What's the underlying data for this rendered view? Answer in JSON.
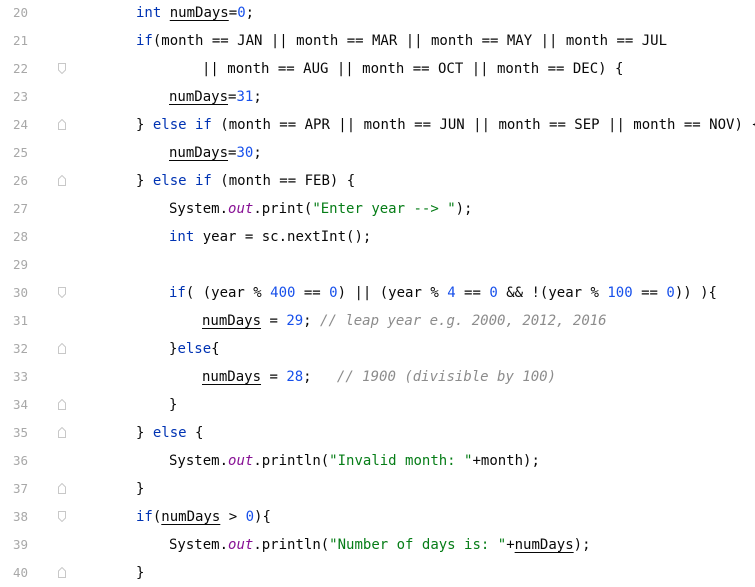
{
  "editor": {
    "lines": [
      {
        "num": "20",
        "fold": false,
        "indent": 0,
        "tokens": [
          [
            "kw",
            "int"
          ],
          [
            "p",
            " "
          ],
          [
            "var",
            "numDays"
          ],
          [
            "p",
            "="
          ],
          [
            "num",
            "0"
          ],
          [
            "p",
            ";"
          ]
        ]
      },
      {
        "num": "21",
        "fold": false,
        "indent": 0,
        "tokens": [
          [
            "kw",
            "if"
          ],
          [
            "p",
            "(month == JAN || month == MAR || month == MAY || month == JUL"
          ]
        ]
      },
      {
        "num": "22",
        "fold": true,
        "foldType": "open",
        "indent": 2,
        "tokens": [
          [
            "p",
            "|| month == AUG || month == OCT || month == DEC) {"
          ]
        ]
      },
      {
        "num": "23",
        "fold": false,
        "indent": 1,
        "tokens": [
          [
            "var",
            "numDays"
          ],
          [
            "p",
            "="
          ],
          [
            "num",
            "31"
          ],
          [
            "p",
            ";"
          ]
        ]
      },
      {
        "num": "24",
        "fold": true,
        "foldType": "mid",
        "indent": 0,
        "tokens": [
          [
            "p",
            "} "
          ],
          [
            "kw",
            "else if"
          ],
          [
            "p",
            " (month == APR || month == JUN || month == SEP || month == NOV) {"
          ]
        ]
      },
      {
        "num": "25",
        "fold": false,
        "indent": 1,
        "tokens": [
          [
            "var",
            "numDays"
          ],
          [
            "p",
            "="
          ],
          [
            "num",
            "30"
          ],
          [
            "p",
            ";"
          ]
        ]
      },
      {
        "num": "26",
        "fold": true,
        "foldType": "mid",
        "indent": 0,
        "tokens": [
          [
            "p",
            "} "
          ],
          [
            "kw",
            "else if"
          ],
          [
            "p",
            " (month == FEB) {"
          ]
        ]
      },
      {
        "num": "27",
        "fold": false,
        "indent": 1,
        "tokens": [
          [
            "p",
            "System."
          ],
          [
            "fld",
            "out"
          ],
          [
            "p",
            ".print("
          ],
          [
            "str",
            "\"Enter year --> \""
          ],
          [
            "p",
            ");"
          ]
        ]
      },
      {
        "num": "28",
        "fold": false,
        "indent": 1,
        "tokens": [
          [
            "kw",
            "int"
          ],
          [
            "p",
            " year = sc.nextInt();"
          ]
        ]
      },
      {
        "num": "29",
        "fold": false,
        "indent": 0,
        "tokens": []
      },
      {
        "num": "30",
        "fold": true,
        "foldType": "open",
        "indent": 1,
        "tokens": [
          [
            "kw",
            "if"
          ],
          [
            "p",
            "( (year % "
          ],
          [
            "num",
            "400"
          ],
          [
            "p",
            " == "
          ],
          [
            "num",
            "0"
          ],
          [
            "p",
            ") || (year % "
          ],
          [
            "num",
            "4"
          ],
          [
            "p",
            " == "
          ],
          [
            "num",
            "0"
          ],
          [
            "p",
            " && !(year % "
          ],
          [
            "num",
            "100"
          ],
          [
            "p",
            " == "
          ],
          [
            "num",
            "0"
          ],
          [
            "p",
            ")) ){"
          ]
        ]
      },
      {
        "num": "31",
        "fold": false,
        "indent": 2,
        "tokens": [
          [
            "var",
            "numDays"
          ],
          [
            "p",
            " = "
          ],
          [
            "num",
            "29"
          ],
          [
            "p",
            "; "
          ],
          [
            "cmt",
            "// leap year e.g. 2000, 2012, 2016"
          ]
        ]
      },
      {
        "num": "32",
        "fold": true,
        "foldType": "mid",
        "indent": 1,
        "tokens": [
          [
            "p",
            "}"
          ],
          [
            "kw",
            "else"
          ],
          [
            "p",
            "{"
          ]
        ]
      },
      {
        "num": "33",
        "fold": false,
        "indent": 2,
        "tokens": [
          [
            "var",
            "numDays"
          ],
          [
            "p",
            " = "
          ],
          [
            "num",
            "28"
          ],
          [
            "p",
            ";   "
          ],
          [
            "cmt",
            "// 1900 (divisible by 100)"
          ]
        ]
      },
      {
        "num": "34",
        "fold": true,
        "foldType": "close",
        "indent": 1,
        "tokens": [
          [
            "p",
            "}"
          ]
        ]
      },
      {
        "num": "35",
        "fold": true,
        "foldType": "mid",
        "indent": 0,
        "tokens": [
          [
            "p",
            "} "
          ],
          [
            "kw",
            "else"
          ],
          [
            "p",
            " {"
          ]
        ]
      },
      {
        "num": "36",
        "fold": false,
        "indent": 1,
        "tokens": [
          [
            "p",
            "System."
          ],
          [
            "fld",
            "out"
          ],
          [
            "p",
            ".println("
          ],
          [
            "str",
            "\"Invalid month: \""
          ],
          [
            "p",
            "+month);"
          ]
        ]
      },
      {
        "num": "37",
        "fold": true,
        "foldType": "close",
        "indent": 0,
        "tokens": [
          [
            "p",
            "}"
          ]
        ]
      },
      {
        "num": "38",
        "fold": true,
        "foldType": "open",
        "indent": 0,
        "tokens": [
          [
            "kw",
            "if"
          ],
          [
            "p",
            "("
          ],
          [
            "var",
            "numDays"
          ],
          [
            "p",
            " > "
          ],
          [
            "num",
            "0"
          ],
          [
            "p",
            "){"
          ]
        ]
      },
      {
        "num": "39",
        "fold": false,
        "indent": 1,
        "tokens": [
          [
            "p",
            "System."
          ],
          [
            "fld",
            "out"
          ],
          [
            "p",
            ".println("
          ],
          [
            "str",
            "\"Number of days is: \""
          ],
          [
            "p",
            "+"
          ],
          [
            "var",
            "numDays"
          ],
          [
            "p",
            ");"
          ]
        ]
      },
      {
        "num": "40",
        "fold": true,
        "foldType": "close",
        "indent": 0,
        "tokens": [
          [
            "p",
            "}"
          ]
        ]
      }
    ]
  },
  "colors": {
    "keyword": "#0033b3",
    "number": "#1750eb",
    "string": "#067d17",
    "comment": "#8c8c8c",
    "field": "#871094",
    "lineNumber": "#a8a8a8"
  }
}
